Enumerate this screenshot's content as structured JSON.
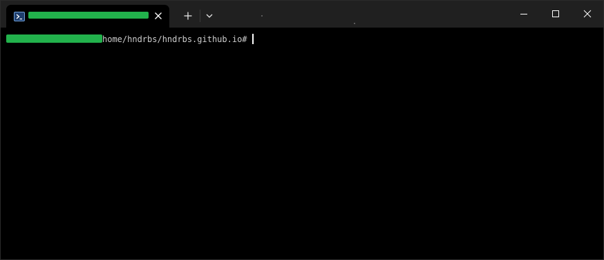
{
  "window": {
    "tab": {
      "icon": "powershell-icon",
      "title_redacted": true,
      "close_icon": "close-icon"
    },
    "new_tab_icon": "plus-icon",
    "tab_dropdown_icon": "chevron-down-icon",
    "controls": {
      "minimize_icon": "minimize-icon",
      "maximize_icon": "maximize-icon",
      "close_icon": "close-icon"
    }
  },
  "terminal": {
    "prompt_user_redacted": true,
    "prompt_path": "home/hndrbs/hndrbs.github.io#",
    "cursor_visible": true
  },
  "colors": {
    "titlebar_bg": "#202020",
    "terminal_bg": "#000000",
    "text": "#cccccc",
    "redaction": "#22b24c"
  }
}
